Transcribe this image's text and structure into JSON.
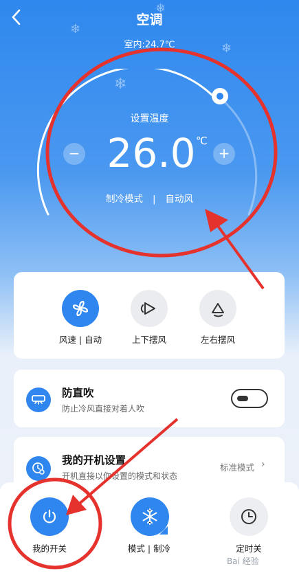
{
  "header": {
    "title": "空调",
    "indoor_temp": "室内:24.7℃"
  },
  "dial": {
    "set_label": "设置温度",
    "temperature": "26.0",
    "unit": "℃",
    "minus": "−",
    "plus": "+",
    "mode": "制冷模式",
    "separator": "|",
    "fan": "自动风"
  },
  "quick_actions": [
    {
      "label": "风速 | 自动",
      "active": true
    },
    {
      "label": "上下摆风",
      "active": false
    },
    {
      "label": "左右摆风",
      "active": false
    }
  ],
  "anti_blow": {
    "title": "防直吹",
    "subtitle": "防止冷风直接对着人吹",
    "enabled": false
  },
  "boot_settings": {
    "title": "我的开机设置",
    "subtitle": "开机直接以你设置的模式和状态",
    "value": "标准模式"
  },
  "bottom_bar": [
    {
      "label": "我的开关"
    },
    {
      "label": "模式 | 制冷"
    },
    {
      "label": "定时关"
    }
  ],
  "colors": {
    "accent": "#2e86ee",
    "annotation": "#e5322d"
  }
}
